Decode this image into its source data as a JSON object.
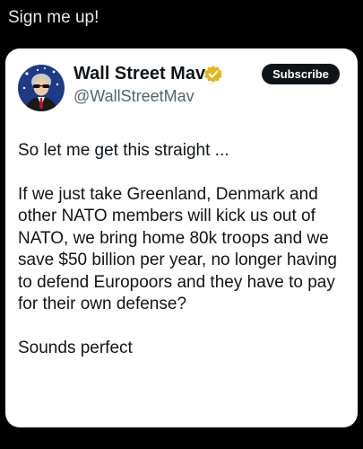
{
  "caption": "Sign me up!",
  "post": {
    "display_name": "Wall Street Mav",
    "handle": "@WallStreetMav",
    "subscribe_label": "Subscribe",
    "paragraphs": [
      "So let me get this straight ...",
      "If we just take Greenland, Denmark and other NATO members will kick us out of NATO, we bring home 80k troops and we save $50 billion per year, no longer having to defend Europoors and they have to pay for their own defense?",
      "Sounds perfect"
    ],
    "verified_icon": "verified-badge-icon",
    "verified_color": "#e2b719"
  },
  "colors": {
    "background": "#000000",
    "card": "#ffffff",
    "text": "#0f1419",
    "secondary_text": "#536471",
    "button": "#0f1419"
  }
}
